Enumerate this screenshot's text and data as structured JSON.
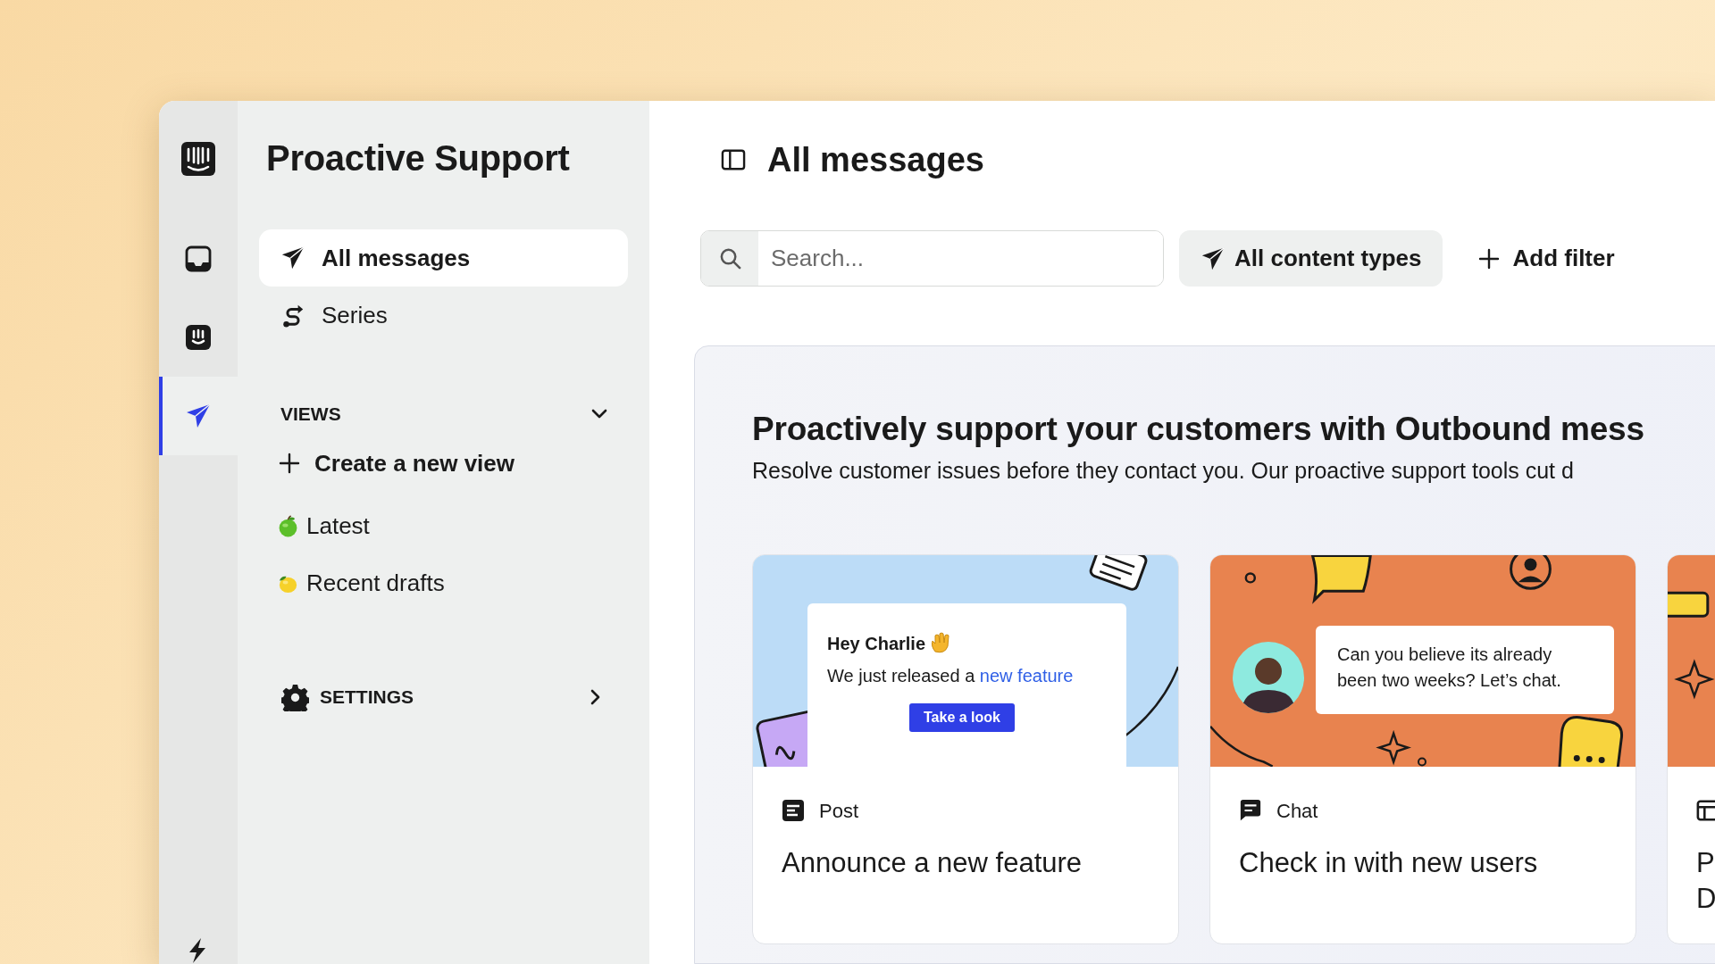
{
  "rail": {
    "items": [
      {
        "kind": "inbox",
        "selected": false
      },
      {
        "kind": "bot",
        "selected": false
      },
      {
        "kind": "outbound",
        "selected": true
      }
    ]
  },
  "sidebar": {
    "title": "Proactive Support",
    "nav": [
      {
        "label": "All messages",
        "kind": "send",
        "selected": true
      },
      {
        "label": "Series",
        "kind": "series",
        "selected": false
      }
    ],
    "views": {
      "heading": "VIEWS",
      "expanded": true,
      "create_label": "Create a new view",
      "items": [
        {
          "label": "Latest",
          "kind": "apple"
        },
        {
          "label": "Recent drafts",
          "kind": "lemon"
        }
      ]
    },
    "settings": {
      "label": "SETTINGS"
    }
  },
  "main": {
    "title": "All messages",
    "search": {
      "placeholder": "Search..."
    },
    "content_type_filter": "All content types",
    "add_filter": "Add filter",
    "banner": {
      "heading": "Proactively support your customers with Outbound mess",
      "subtitle": "Resolve customer issues before they contact you. Our proactive support tools cut d",
      "cards": [
        {
          "kind": "post",
          "type": "Post",
          "title_lines": [
            "Announce a new feature"
          ],
          "preview": {
            "greeting": "Hey Charlie",
            "text": "We just released a",
            "link": "new feature",
            "button": "Take a look"
          }
        },
        {
          "kind": "chat",
          "type": "Chat",
          "title_lines": [
            "Check in with new users"
          ],
          "preview": {
            "message": "Can you believe its already been two weeks? Let’s chat."
          }
        },
        {
          "kind": "article",
          "title_lines": [
            "P",
            "D"
          ]
        }
      ]
    }
  }
}
